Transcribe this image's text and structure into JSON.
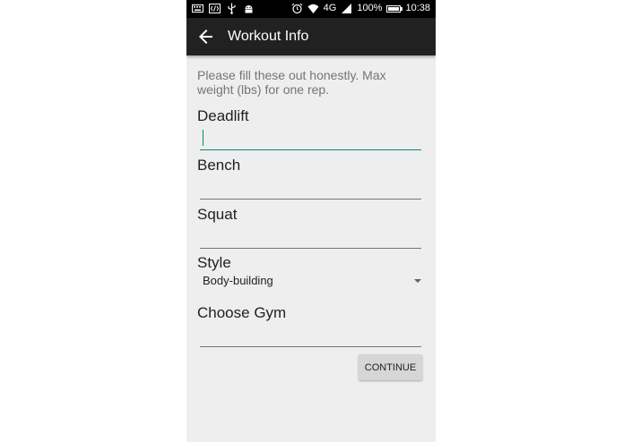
{
  "status_bar": {
    "icons_left": [
      "keyboard-icon",
      "code-icon",
      "usb-icon",
      "android-debug-icon"
    ],
    "icons_right": [
      "alarm-icon",
      "wifi-icon",
      "4g-lte-icon",
      "signal-icon"
    ],
    "network": "4G",
    "battery": "100%",
    "time": "10:38"
  },
  "toolbar": {
    "title": "Workout Info"
  },
  "form": {
    "intro": "Please fill these out honestly. Max weight (lbs) for one rep.",
    "deadlift_label": "Deadlift",
    "deadlift_value": "",
    "bench_label": "Bench",
    "bench_value": "",
    "squat_label": "Squat",
    "squat_value": "",
    "style_label": "Style",
    "style_value": "Body-building",
    "gym_label": "Choose Gym",
    "gym_value": "",
    "continue_label": "CONTINUE"
  },
  "colors": {
    "toolbar": "#212121",
    "background": "#eeeeee",
    "accent": "#00897b"
  }
}
